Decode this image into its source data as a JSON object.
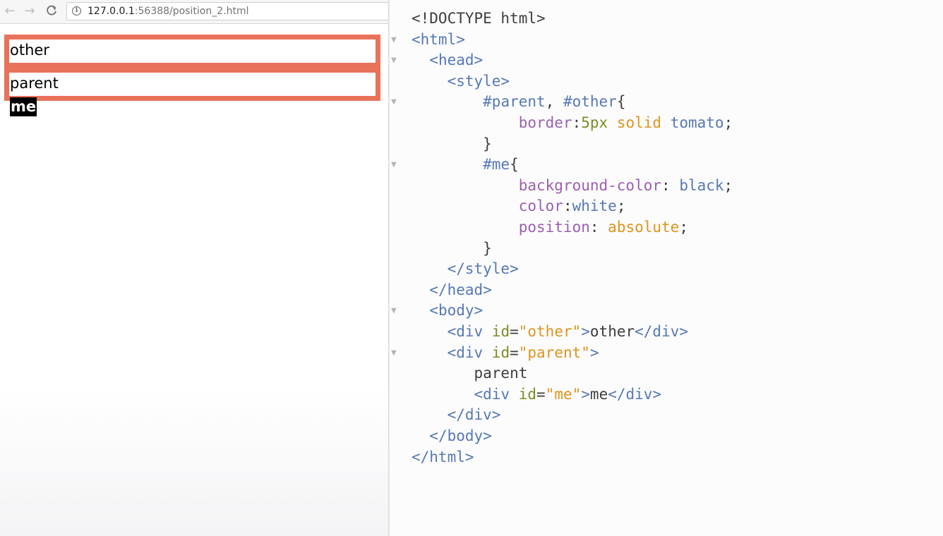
{
  "browser": {
    "nav": {
      "back": "←",
      "forward": "→",
      "reload": "C"
    },
    "address": {
      "host": "127.0.0.1",
      "rest": ":56388/position_2.html"
    },
    "page": {
      "other_text": "other",
      "parent_text": "parent",
      "me_text": "me"
    },
    "colors": {
      "border": "#e8735a",
      "me_bg": "#000000",
      "me_fg": "#ffffff"
    }
  },
  "editor": {
    "lines": [
      {
        "fold": "",
        "segments": [
          {
            "cls": "plain",
            "text": "<!DOCTYPE html>"
          }
        ]
      },
      {
        "fold": "▼",
        "segments": [
          {
            "cls": "tag",
            "text": "<html>"
          }
        ]
      },
      {
        "fold": "▼",
        "segments": [
          {
            "cls": "plain",
            "text": "  "
          },
          {
            "cls": "tag",
            "text": "<head>"
          }
        ]
      },
      {
        "fold": "",
        "segments": [
          {
            "cls": "plain",
            "text": "    "
          },
          {
            "cls": "tag",
            "text": "<style>"
          }
        ]
      },
      {
        "fold": "▼",
        "segments": [
          {
            "cls": "plain",
            "text": "        "
          },
          {
            "cls": "sel",
            "text": "#parent"
          },
          {
            "cls": "plain",
            "text": ", "
          },
          {
            "cls": "sel",
            "text": "#other"
          },
          {
            "cls": "plain",
            "text": "{"
          }
        ]
      },
      {
        "fold": "",
        "segments": [
          {
            "cls": "plain",
            "text": "            "
          },
          {
            "cls": "prop",
            "text": "border"
          },
          {
            "cls": "plain",
            "text": ":"
          },
          {
            "cls": "num",
            "text": "5px"
          },
          {
            "cls": "plain",
            "text": " "
          },
          {
            "cls": "kw",
            "text": "solid"
          },
          {
            "cls": "plain",
            "text": " "
          },
          {
            "cls": "val",
            "text": "tomato"
          },
          {
            "cls": "plain",
            "text": ";"
          }
        ]
      },
      {
        "fold": "",
        "segments": [
          {
            "cls": "plain",
            "text": "        }"
          }
        ]
      },
      {
        "fold": "▼",
        "segments": [
          {
            "cls": "plain",
            "text": "        "
          },
          {
            "cls": "sel",
            "text": "#me"
          },
          {
            "cls": "plain",
            "text": "{"
          }
        ]
      },
      {
        "fold": "",
        "segments": [
          {
            "cls": "plain",
            "text": "            "
          },
          {
            "cls": "prop",
            "text": "background-color"
          },
          {
            "cls": "plain",
            "text": ": "
          },
          {
            "cls": "val",
            "text": "black"
          },
          {
            "cls": "plain",
            "text": ";"
          }
        ]
      },
      {
        "fold": "",
        "segments": [
          {
            "cls": "plain",
            "text": "            "
          },
          {
            "cls": "prop",
            "text": "color"
          },
          {
            "cls": "plain",
            "text": ":"
          },
          {
            "cls": "val",
            "text": "white"
          },
          {
            "cls": "plain",
            "text": ";"
          }
        ]
      },
      {
        "fold": "",
        "segments": [
          {
            "cls": "plain",
            "text": "            "
          },
          {
            "cls": "prop",
            "text": "position"
          },
          {
            "cls": "plain",
            "text": ": "
          },
          {
            "cls": "kw",
            "text": "absolute"
          },
          {
            "cls": "plain",
            "text": ";"
          }
        ]
      },
      {
        "fold": "",
        "segments": [
          {
            "cls": "plain",
            "text": "        }"
          }
        ]
      },
      {
        "fold": "",
        "segments": [
          {
            "cls": "plain",
            "text": "    "
          },
          {
            "cls": "tag",
            "text": "</style>"
          }
        ]
      },
      {
        "fold": "",
        "segments": [
          {
            "cls": "plain",
            "text": "  "
          },
          {
            "cls": "tag",
            "text": "</head>"
          }
        ]
      },
      {
        "fold": "▼",
        "segments": [
          {
            "cls": "plain",
            "text": "  "
          },
          {
            "cls": "tag",
            "text": "<body>"
          }
        ]
      },
      {
        "fold": "",
        "segments": [
          {
            "cls": "plain",
            "text": "    "
          },
          {
            "cls": "tag",
            "text": "<div "
          },
          {
            "cls": "attr",
            "text": "id"
          },
          {
            "cls": "plain",
            "text": "="
          },
          {
            "cls": "str",
            "text": "\"other\""
          },
          {
            "cls": "tag",
            "text": ">"
          },
          {
            "cls": "plain",
            "text": "other"
          },
          {
            "cls": "tag",
            "text": "</div>"
          }
        ]
      },
      {
        "fold": "▼",
        "segments": [
          {
            "cls": "plain",
            "text": "    "
          },
          {
            "cls": "tag",
            "text": "<div "
          },
          {
            "cls": "attr",
            "text": "id"
          },
          {
            "cls": "plain",
            "text": "="
          },
          {
            "cls": "str",
            "text": "\"parent\""
          },
          {
            "cls": "tag",
            "text": ">"
          }
        ]
      },
      {
        "fold": "",
        "segments": [
          {
            "cls": "plain",
            "text": "       parent"
          }
        ]
      },
      {
        "fold": "",
        "segments": [
          {
            "cls": "plain",
            "text": "       "
          },
          {
            "cls": "tag",
            "text": "<div "
          },
          {
            "cls": "attr",
            "text": "id"
          },
          {
            "cls": "plain",
            "text": "="
          },
          {
            "cls": "str",
            "text": "\"me\""
          },
          {
            "cls": "tag",
            "text": ">"
          },
          {
            "cls": "plain",
            "text": "me"
          },
          {
            "cls": "tag",
            "text": "</div>"
          }
        ]
      },
      {
        "fold": "",
        "segments": [
          {
            "cls": "plain",
            "text": "    "
          },
          {
            "cls": "tag",
            "text": "</div>"
          }
        ]
      },
      {
        "fold": "",
        "segments": [
          {
            "cls": "plain",
            "text": "  "
          },
          {
            "cls": "tag",
            "text": "</body>"
          }
        ]
      },
      {
        "fold": "",
        "segments": [
          {
            "cls": "tag",
            "text": "</html>"
          }
        ]
      }
    ]
  }
}
